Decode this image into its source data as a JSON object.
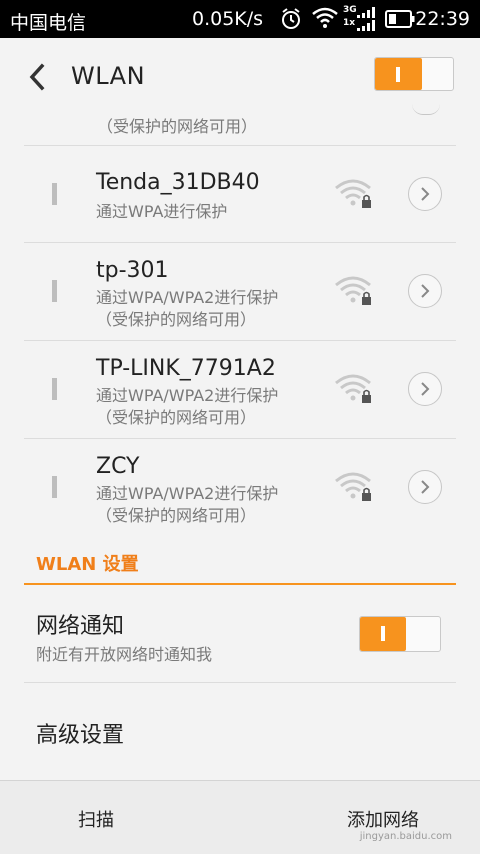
{
  "status_bar": {
    "carrier": "中国电信",
    "speed": "0.05K/s",
    "network_type_top": "3G",
    "network_type_bottom": "1x",
    "time": "22:39"
  },
  "header": {
    "title": "WLAN",
    "wlan_enabled": true
  },
  "networks_partial": {
    "sub": "（受保护的网络可用）"
  },
  "networks": [
    {
      "ssid": "Tenda_31DB40",
      "security": "通过WPA进行保护",
      "extra": ""
    },
    {
      "ssid": "tp-301",
      "security": "通过WPA/WPA2进行保护",
      "extra": "（受保护的网络可用）"
    },
    {
      "ssid": "TP-LINK_7791A2",
      "security": "通过WPA/WPA2进行保护",
      "extra": "（受保护的网络可用）"
    },
    {
      "ssid": "ZCY",
      "security": "通过WPA/WPA2进行保护",
      "extra": "（受保护的网络可用）"
    }
  ],
  "settings": {
    "section_title": "WLAN 设置",
    "notify_title": "网络通知",
    "notify_sub": "附近有开放网络时通知我",
    "notify_enabled": true,
    "advanced_title": "高级设置"
  },
  "bottom_bar": {
    "scan_label": "扫描",
    "add_label": "添加网络"
  },
  "watermark": "jingyan.baidu.com",
  "colors": {
    "accent": "#f7931e",
    "section_text": "#f07f1a"
  }
}
